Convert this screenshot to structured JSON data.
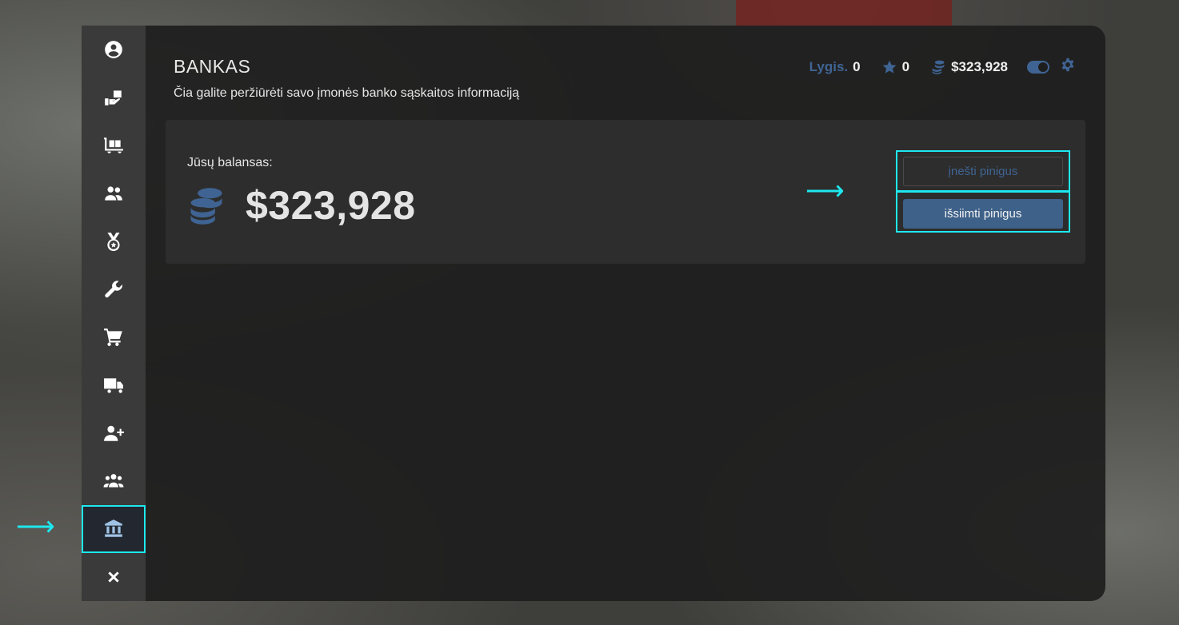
{
  "header": {
    "title": "BANKAS",
    "subtitle": "Čia galite peržiūrėti savo įmonės banko sąskaitos informaciją"
  },
  "stats": {
    "level_label": "Lygis.",
    "level_value": "0",
    "stars_value": "0",
    "money_value": "$323,928",
    "toggle_state": "on"
  },
  "balance": {
    "label": "Jūsų balansas:",
    "amount": "$323,928"
  },
  "actions": {
    "deposit_label": "įnešti pinigus",
    "withdraw_label": "išsiimti pinigus"
  },
  "sidebar": {
    "items": [
      {
        "icon": "user-circle-icon"
      },
      {
        "icon": "hand-truck-icon"
      },
      {
        "icon": "dolly-flatbed-icon"
      },
      {
        "icon": "users-icon"
      },
      {
        "icon": "medal-icon"
      },
      {
        "icon": "wrench-icon"
      },
      {
        "icon": "shopping-cart-icon"
      },
      {
        "icon": "truck-icon"
      },
      {
        "icon": "user-plus-icon"
      },
      {
        "icon": "users-group-icon"
      },
      {
        "icon": "bank-icon",
        "active": true
      },
      {
        "icon": "close-icon"
      }
    ]
  },
  "colors": {
    "accent": "#3f6493",
    "highlight": "#1ee8ef",
    "panel": "#1e1e1e",
    "sidebar": "#3a3a3a"
  }
}
